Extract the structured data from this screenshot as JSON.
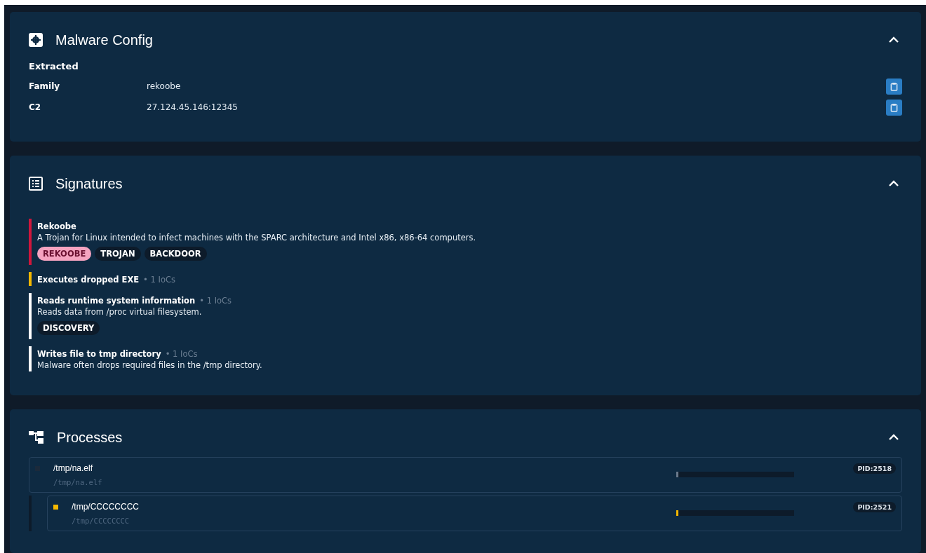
{
  "config": {
    "title": "Malware Config",
    "expanded": true,
    "heading": "Extracted",
    "rows": [
      {
        "label": "Family",
        "value": "rekoobe"
      },
      {
        "label": "C2",
        "value": "27.124.45.146:12345"
      }
    ]
  },
  "signatures": {
    "title": "Signatures",
    "expanded": true,
    "items": [
      {
        "name": "Rekoobe",
        "color": "#d0163c",
        "description": "A Trojan for Linux intended to infect machines with the SPARC architecture and Intel x86, x86-64 computers.",
        "tags": [
          {
            "label": "REKOOBE",
            "kind": "family"
          },
          {
            "label": "TROJAN",
            "kind": "ttp"
          },
          {
            "label": "BACKDOOR",
            "kind": "ttp"
          }
        ]
      },
      {
        "name": "Executes dropped EXE",
        "color": "#f5b800",
        "iocs": "• 1 IoCs"
      },
      {
        "name": "Reads runtime system information",
        "color": "#ffffff",
        "iocs": "• 1 IoCs",
        "description": "Reads data from /proc virtual filesystem.",
        "tags": [
          {
            "label": "DISCOVERY",
            "kind": "ttp"
          }
        ]
      },
      {
        "name": "Writes file to tmp directory",
        "color": "#ffffff",
        "iocs": "• 1 IoCs",
        "description": "Malware often drops required files in the /tmp directory."
      }
    ]
  },
  "processes": {
    "title": "Processes",
    "expanded": true,
    "items": [
      {
        "name": "/tmp/na.elf",
        "command": "/tmp/na.elf",
        "color": "#1b2a3b",
        "level": 0.01,
        "pid": "PID:2518",
        "children": [
          {
            "name": "/tmp/CCCCCCCC",
            "command": "/tmp/CCCCCCCC",
            "color": "#f5b800",
            "level": 0.01,
            "pid": "PID:2521"
          }
        ]
      }
    ]
  }
}
